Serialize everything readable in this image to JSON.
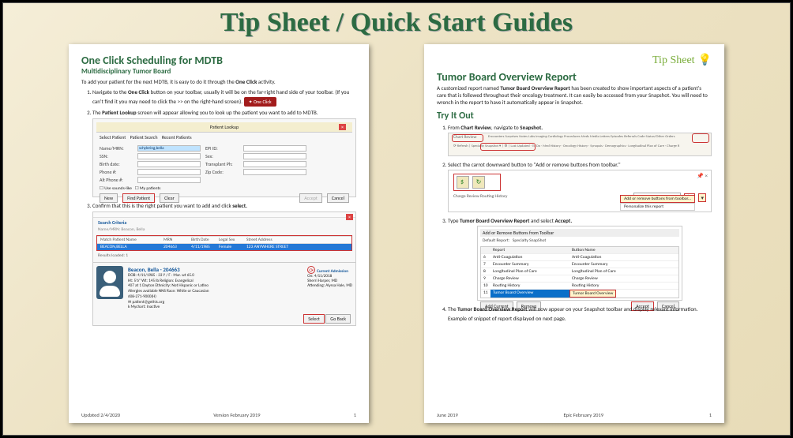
{
  "slide_title": "Tip Sheet / Quick Start Guides",
  "left": {
    "title": "One Click Scheduling for MDTB",
    "subtitle": "Multidisciplinary Tumor Board",
    "intro_a": "To add your patient for the next MDTB, it is easy to do it through the ",
    "intro_b": "One Click",
    "intro_c": " activity.",
    "step1_a": "Navigate to the ",
    "step1_b": "One Click",
    "step1_c": " button on your toolbar, usually it will be on the far-right hand side of your toolbar.  (If you can't find it you may need to click the >> on the right-hand screen).",
    "one_click_btn": "✦ One Click",
    "step2_a": "The ",
    "step2_b": "Patient Lookup",
    "step2_c": " screen will appear allowing you to look up the patient you want to add to MDTB.",
    "lookup": {
      "header": "Patient Lookup",
      "tabs": {
        "t1": "Select Patient",
        "t2": "Patient Search",
        "t3": "Recent Patients"
      },
      "labels": {
        "name": "Name/MRN:",
        "epi": "EPI ID:",
        "ssn": "SSN:",
        "sex": "Sex:",
        "bdate": "Birth date:",
        "tphone": "Transplant Ph:",
        "phone": "Phone #:",
        "zip": "Zip Code:",
        "altphone": "Alt Phone #:"
      },
      "name_value": "schylering,bella",
      "chk1": "Use sounds-like",
      "chk2": "My patients",
      "btns": {
        "new": "New",
        "find": "Find Patient",
        "clear": "Clear",
        "accept": "Accept",
        "cancel": "Cancel"
      }
    },
    "step3_a": "Confirm that this is the right patient you want to add and click ",
    "step3_b": "select.",
    "confirm": {
      "crit_hd": "Search Criteria",
      "crit_val": "Name/MRN: Beacon, Bella",
      "cols": {
        "c1": "Match Patient Name",
        "c2": "MRN",
        "c3": "Birth Date",
        "c4": "Legal Sex",
        "c5": "Street Address"
      },
      "row": {
        "name": "BEACON,BELLA",
        "mrn": "204663",
        "bdate": "4/11/1985",
        "sex": "Female",
        "addr": "123 ANYWHERE STREET"
      },
      "results": "Results loaded: 1",
      "card": {
        "name": "Beacon, Bella - 204663",
        "l1": "DOB: 4/11/1985   ·   33 Y / F · Mar. wt 65.0",
        "l2": "Ht: 5'6\"   Wt: 145 lb   Religion: Evangelical",
        "l3": "407 at 1 Dayton   Ethnicity: Not Hispanic or Latino",
        "l4": "Allergies available NNS   Race: White or Caucasian",
        "l5": "608-271-9000(H)",
        "l6": "✉ patient@gethis.org",
        "l7": "k Mychart: Inactive",
        "adm_hd": "Current Admission",
        "adm1": "On: 4/11/2018",
        "adm2": "Sherri Harper, MD",
        "adm3": "Attending: Alyssa Hale, MD"
      },
      "btns": {
        "select": "Select",
        "back": "Go Back"
      }
    },
    "footer": {
      "left": "Updated 2/4/2020",
      "mid": "Version February 2019",
      "right": "1"
    }
  },
  "right": {
    "banner": "Tip Sheet",
    "title": "Tumor Board Overview Report",
    "intro_a": "A customized report named ",
    "intro_b": "Tumor Board Overview Report",
    "intro_c": " has been created to show important aspects of a patient's care that is followed throughout their oncology treatment.  It can easily be accessed from your Snapshot.  You will need to wrench in the report to have it automatically appear in Snapshot.",
    "tryit": "Try It Out",
    "s1_a": "From ",
    "s1_b": "Chart Review",
    "s1_c": ", navigate to ",
    "s1_d": "Snapshot.",
    "toolbar": {
      "tag": "Chart Review",
      "row1": "Encounters  Surprises  Notes  Labs  Imaging  Cardiology  Procedures  Meds  Media  Letters  Episodes  Referrals  Code Status/Other Orders",
      "row2": "⟳ Refresh  |  Specialty Snapshot  ▾  |  ⚙  |  Last Updated  ·  To Do  ·  Med History  ·  Oncology History  ·  Synopsis  ·  Demographics  ·  Longitudinal Plan of Care  ·  Charge R"
    },
    "s2": "Select the carrot downward button to \"Add or remove buttons from toolbar.\"",
    "carrot": {
      "labels": "Charge Review     Routing History",
      "selbox": "Specialty SnapShot",
      "menu1": "Add or remove buttons from toolbar...",
      "menu2": "Personalize this report"
    },
    "s3_a": "Type ",
    "s3_b": "Tumor Board Overview Report",
    "s3_c": " and select ",
    "s3_d": "Accept.",
    "addrem": {
      "title": "Add or Remove Buttons from Toolbar",
      "default_lbl": "Default Report:",
      "default_val": "Specialty SnapShot",
      "col1": "Report",
      "col2": "Button Name",
      "rows": [
        {
          "n": "6",
          "a": "Anti-Coagulation",
          "b": "Anti-Coagulation"
        },
        {
          "n": "7",
          "a": "Encounter Summary",
          "b": "Encounter Summary"
        },
        {
          "n": "8",
          "a": "Longitudinal Plan of Care",
          "b": "Longitudinal Plan of Care"
        },
        {
          "n": "9",
          "a": "Charge Review",
          "b": "Charge Review"
        },
        {
          "n": "10",
          "a": "Routing History",
          "b": "Routing History"
        },
        {
          "n": "11",
          "a": "Tumor Board Overview",
          "b": "Tumor Board Overview"
        }
      ],
      "btns": {
        "add": "Add Current",
        "remove": "Remove",
        "accept": "Accept",
        "cancel": "Cancel"
      }
    },
    "s4_a": "The ",
    "s4_b": "Tumor Board Overview Report",
    "s4_c": " will now appear on your Snapshot toolbar and display relevant information.",
    "s4_note": "Example of snippet of report displayed on next page.",
    "footer": {
      "left": "June 2019",
      "mid": "Epic February 2019",
      "right": "1"
    }
  }
}
